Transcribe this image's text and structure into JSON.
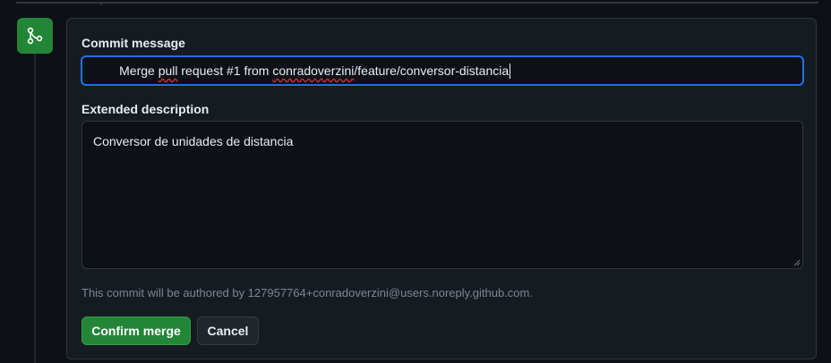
{
  "merge_form": {
    "commit_message_label": "Commit message",
    "commit_message_prefix": "Merge ",
    "commit_message_misspelled_1": "pull",
    "commit_message_mid_1": " request #1 from ",
    "commit_message_misspelled_2": "conradoverzini",
    "commit_message_suffix": "/feature/conversor-distancia",
    "extended_description_label": "Extended description",
    "extended_description_value": "Conversor de unidades de distancia",
    "author_note": "This commit will be authored by 127957764+conradoverzini@users.noreply.github.com.",
    "confirm_label": "Confirm merge",
    "cancel_label": "Cancel"
  },
  "icons": {
    "badge": "git-merge-icon"
  },
  "colors": {
    "background": "#0d1117",
    "panel": "#161b22",
    "accent_green": "#238636",
    "focus_blue": "#1f6feb",
    "muted_text": "#7d8590",
    "spellcheck_red": "#d12d2d"
  }
}
